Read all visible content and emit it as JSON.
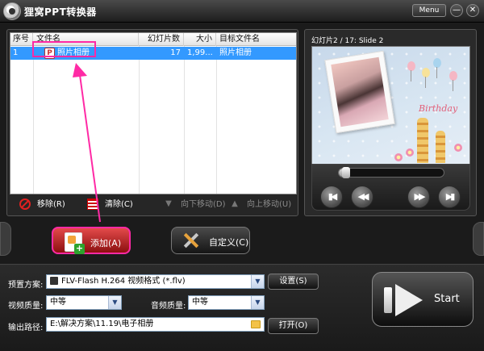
{
  "window": {
    "title": "狸窝PPT转换器",
    "menu_label": "Menu",
    "min_glyph": "—",
    "close_glyph": "✕"
  },
  "file_list": {
    "columns": [
      "序号",
      "文件名",
      "幻灯片数",
      "大小",
      "目标文件名"
    ],
    "rows": [
      {
        "index": "1",
        "filename": "照片相册",
        "slides": "17",
        "size": "1,99...",
        "target": "照片相册",
        "selected": true
      }
    ],
    "highlight_color": "#3399ff"
  },
  "list_toolbar": {
    "remove": "移除(R)",
    "clear": "清除(C)",
    "move_down": "向下移动(D)",
    "move_up": "向上移动(U)"
  },
  "preview": {
    "caption": "幻灯片2 / 17: Slide 2",
    "slide_text": "Birthday",
    "seek_progress": 0.03,
    "controls": [
      "first",
      "prev",
      "next",
      "last"
    ]
  },
  "actions": {
    "add_label": "添加(A)",
    "custom_label": "自定义(C)"
  },
  "settings": {
    "preset_label": "预置方案:",
    "preset_value": "FLV-Flash H.264 视频格式 (*.flv)",
    "settings_button": "设置(S)",
    "video_quality_label": "视频质量:",
    "video_quality_value": "中等",
    "audio_quality_label": "音频质量:",
    "audio_quality_value": "中等",
    "output_path_label": "输出路径:",
    "output_path_value": "E:\\解决方案\\11.19\\电子相册",
    "open_button": "打开(O)",
    "start_label": "Start"
  },
  "annotation_color": "#ff2aa5",
  "accent_color": "#e24a4a"
}
